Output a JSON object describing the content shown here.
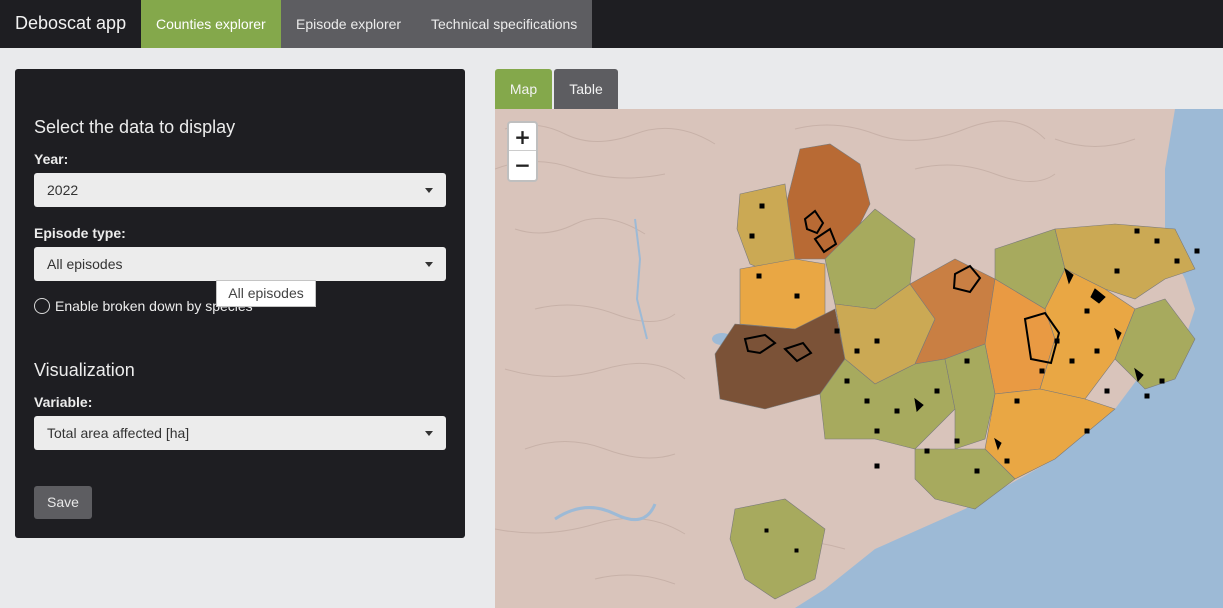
{
  "navbar": {
    "brand": "Deboscat app",
    "tabs": [
      {
        "label": "Counties explorer",
        "active": true
      },
      {
        "label": "Episode explorer",
        "active": false
      },
      {
        "label": "Technical specifications",
        "active": false
      }
    ]
  },
  "sidebar": {
    "data_section_title": "Select the data to display",
    "year": {
      "label": "Year:",
      "value": "2022"
    },
    "episode_type": {
      "label": "Episode type:",
      "value": "All episodes"
    },
    "species_toggle": {
      "label": "Enable broken down by species",
      "checked": false
    },
    "visualization_title": "Visualization",
    "variable": {
      "label": "Variable:",
      "value": "Total area affected [ha]"
    },
    "save_label": "Save"
  },
  "tooltip": {
    "text": "All episodes"
  },
  "map_tabs": [
    {
      "label": "Map",
      "active": true
    },
    {
      "label": "Table",
      "active": false
    }
  ],
  "map": {
    "zoom_in": "+",
    "zoom_out": "−",
    "colors": {
      "sea": "#9dbad6",
      "land": "#d9c4bb",
      "low": "#a7aa5e",
      "mid_low": "#cba954",
      "mid": "#e9a744",
      "mid_high": "#e99a43",
      "high": "#c97f43",
      "very_high": "#b86a34",
      "max": "#7b5237",
      "episodes": "#000000"
    }
  },
  "theme": {
    "accent": "#84a84b",
    "dark": "#1e1e22",
    "button": "#5d5d61"
  }
}
